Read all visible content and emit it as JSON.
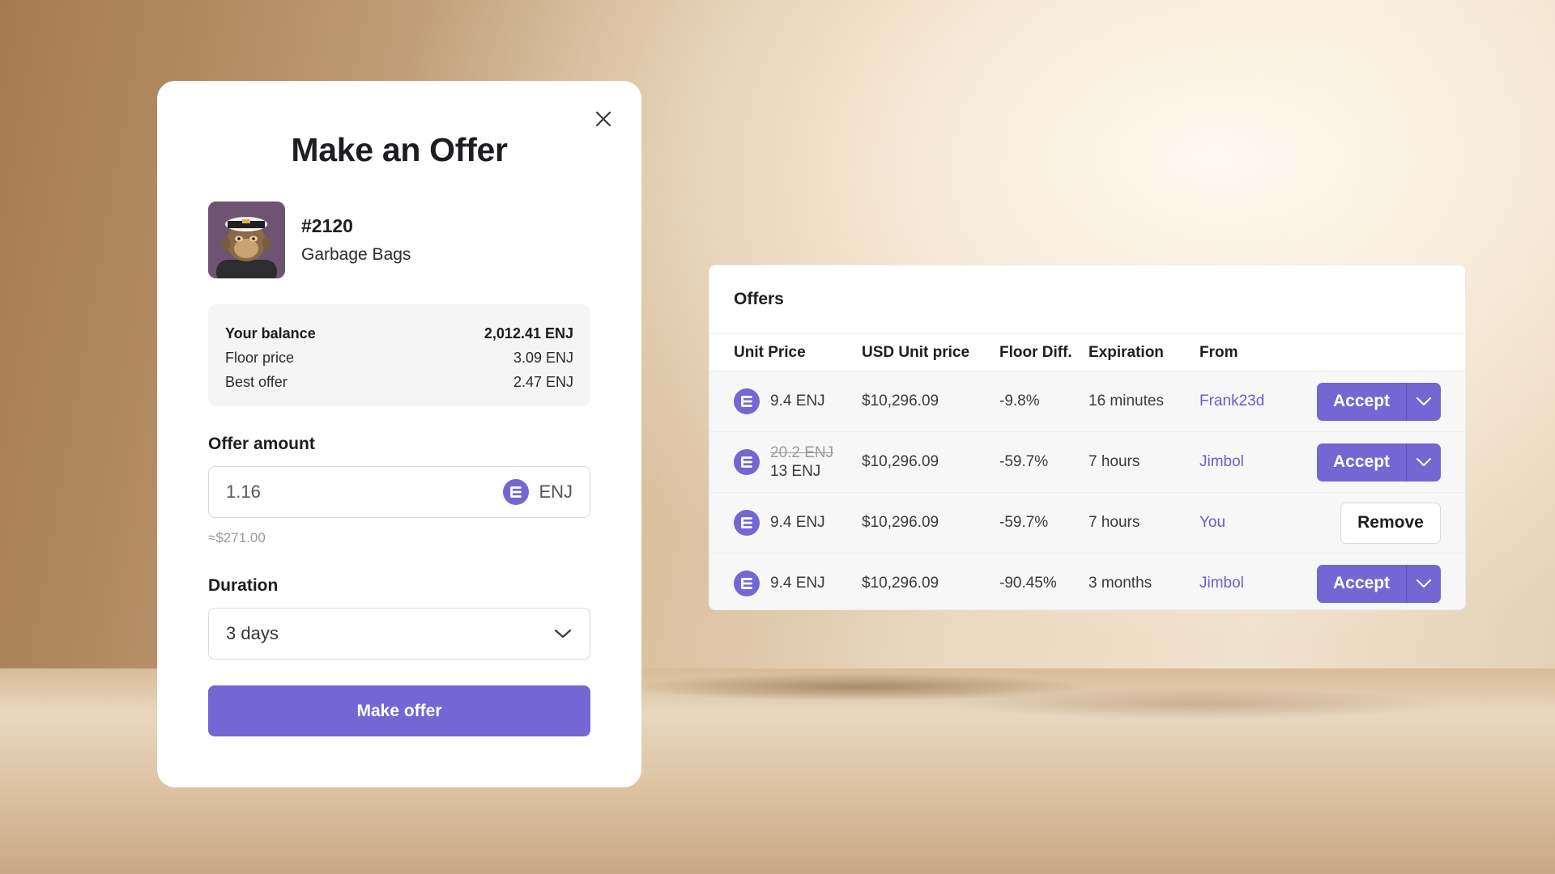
{
  "modal": {
    "title": "Make an Offer",
    "item": {
      "id": "#2120",
      "name": "Garbage Bags"
    },
    "balance": {
      "rows": [
        {
          "label": "Your balance",
          "value": "2,012.41 ENJ"
        },
        {
          "label": "Floor price",
          "value": "3.09 ENJ"
        },
        {
          "label": "Best offer",
          "value": "2.47 ENJ"
        }
      ]
    },
    "offer_amount": {
      "label": "Offer amount",
      "value": "1.16",
      "currency": "ENJ",
      "usd_approx": "≈$271.00"
    },
    "duration": {
      "label": "Duration",
      "value": "3 days"
    },
    "submit_label": "Make offer"
  },
  "offers": {
    "title": "Offers",
    "columns": [
      "Unit Price",
      "USD Unit price",
      "Floor Diff.",
      "Expiration",
      "From"
    ],
    "rows": [
      {
        "price": "9.4 ENJ",
        "old_price": "",
        "usd": "$10,296.09",
        "floor_diff": "-9.8%",
        "expiration": "16 minutes",
        "from": "Frank23d",
        "action": "Accept"
      },
      {
        "price": "13 ENJ",
        "old_price": "20.2 ENJ",
        "usd": "$10,296.09",
        "floor_diff": "-59.7%",
        "expiration": "7 hours",
        "from": "Jimbol",
        "action": "Accept"
      },
      {
        "price": "9.4 ENJ",
        "old_price": "",
        "usd": "$10,296.09",
        "floor_diff": "-59.7%",
        "expiration": "7 hours",
        "from": "You",
        "action": "Remove"
      },
      {
        "price": "9.4 ENJ",
        "old_price": "",
        "usd": "$10,296.09",
        "floor_diff": "-90.45%",
        "expiration": "3 months",
        "from": "Jimbol",
        "action": "Accept"
      }
    ]
  },
  "icons": {
    "close": "close-icon",
    "coin": "enj-coin-icon",
    "dropdown": "chevron-down-icon"
  },
  "colors": {
    "accent": "#7466d3",
    "link": "#6c5ccf",
    "coin": "#7466d3"
  }
}
